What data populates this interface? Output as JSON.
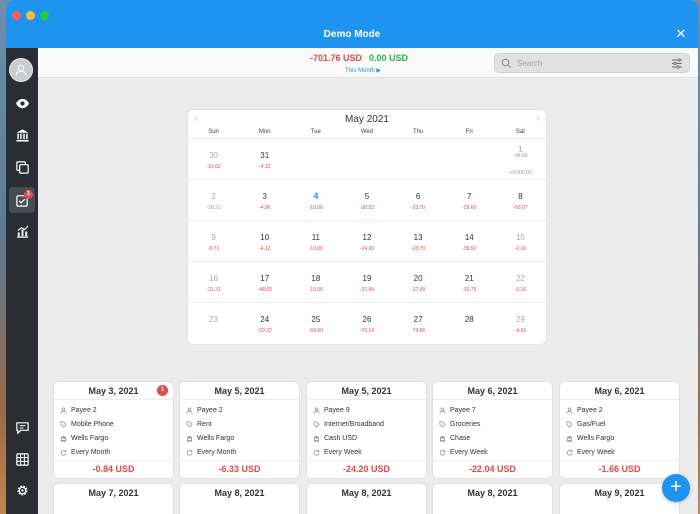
{
  "window": {
    "title": "Demo Mode"
  },
  "topbar": {
    "sum_negative": "-701.76 USD",
    "sum_positive": "0.00 USD",
    "period": "This Month ▶",
    "search_placeholder": "Search"
  },
  "sidebar": {
    "items": [
      {
        "name": "avatar",
        "icon": "user-icon"
      },
      {
        "name": "overview",
        "icon": "eye-icon"
      },
      {
        "name": "accounts",
        "icon": "bank-icon"
      },
      {
        "name": "transactions",
        "icon": "copy-icon"
      },
      {
        "name": "scheduled",
        "icon": "checklist-icon",
        "badge": "1"
      },
      {
        "name": "reports",
        "icon": "chart-icon"
      },
      {
        "name": "notes",
        "icon": "message-icon"
      },
      {
        "name": "budget",
        "icon": "grid-icon"
      },
      {
        "name": "settings",
        "icon": "gear-icon"
      }
    ]
  },
  "calendar": {
    "month": "May 2021",
    "days_of_week": [
      "Sun",
      "Mon",
      "Tue",
      "Wed",
      "Thu",
      "Fri",
      "Sat"
    ],
    "weeks": [
      [
        {
          "d": "30",
          "a": "-10.62",
          "m": true
        },
        {
          "d": "31",
          "a": "-4.12"
        },
        {
          "d": ""
        },
        {
          "d": ""
        },
        {
          "d": ""
        },
        {
          "d": ""
        },
        {
          "d": "1",
          "a": "-46.66",
          "a2": "+4,000.00",
          "m": true
        }
      ],
      [
        {
          "d": "2",
          "a": "-16.21",
          "m": true
        },
        {
          "d": "3",
          "a": "-4.96"
        },
        {
          "d": "4",
          "a": "-10.06",
          "today": true
        },
        {
          "d": "5",
          "a": "-30.53"
        },
        {
          "d": "6",
          "a": "-23.70"
        },
        {
          "d": "7",
          "a": "-29.60"
        },
        {
          "d": "8",
          "a": "-60.97"
        }
      ],
      [
        {
          "d": "9",
          "a": "-5.71",
          "m": true
        },
        {
          "d": "10",
          "a": "-4.12"
        },
        {
          "d": "11",
          "a": "-10.06"
        },
        {
          "d": "12",
          "a": "-24.20"
        },
        {
          "d": "13",
          "a": "-23.70"
        },
        {
          "d": "14",
          "a": "-39.92"
        },
        {
          "d": "15",
          "a": "-0.16",
          "m": true
        }
      ],
      [
        {
          "d": "16",
          "a": "-21.31",
          "m": true
        },
        {
          "d": "17",
          "a": "-48.09"
        },
        {
          "d": "18",
          "a": "-10.06"
        },
        {
          "d": "19",
          "a": "-37.84"
        },
        {
          "d": "20",
          "a": "-37.99"
        },
        {
          "d": "21",
          "a": "-10.76"
        },
        {
          "d": "22",
          "a": "-0.16",
          "m": true
        }
      ],
      [
        {
          "d": "23",
          "m": true
        },
        {
          "d": "24",
          "a": "-29.32"
        },
        {
          "d": "25",
          "a": "-69.60"
        },
        {
          "d": "26",
          "a": "-70.14"
        },
        {
          "d": "27",
          "a": "-74.56"
        },
        {
          "d": "28"
        },
        {
          "d": "29",
          "a": "-4.66",
          "m": true
        }
      ]
    ]
  },
  "cards": [
    {
      "date": "May 3, 2021",
      "payee": "Payee 2",
      "category": "Mobile Phone",
      "account": "Wells Fargo",
      "recurrence": "Every Month",
      "amount": "-0.84 USD",
      "badge": "1"
    },
    {
      "date": "May 5, 2021",
      "payee": "Payee 2",
      "category": "Rent",
      "account": "Wells Fargo",
      "recurrence": "Every Month",
      "amount": "-6.33 USD"
    },
    {
      "date": "May 5, 2021",
      "payee": "Payee 9",
      "category": "Internet/Broadband",
      "account": "Cash USD",
      "recurrence": "Every Week",
      "amount": "-24.20 USD"
    },
    {
      "date": "May 6, 2021",
      "payee": "Payee 7",
      "category": "Groceries",
      "account": "Chase",
      "recurrence": "Every Week",
      "amount": "-22.04 USD"
    },
    {
      "date": "May 6, 2021",
      "payee": "Payee 2",
      "category": "Gas/Fuel",
      "account": "Wells Fargo",
      "recurrence": "Every Week",
      "amount": "-1.66 USD"
    }
  ],
  "cards_next_row": [
    "May 7, 2021",
    "May 8, 2021",
    "May 8, 2021",
    "May 8, 2021",
    "May 9, 2021"
  ],
  "fab_label": "+"
}
